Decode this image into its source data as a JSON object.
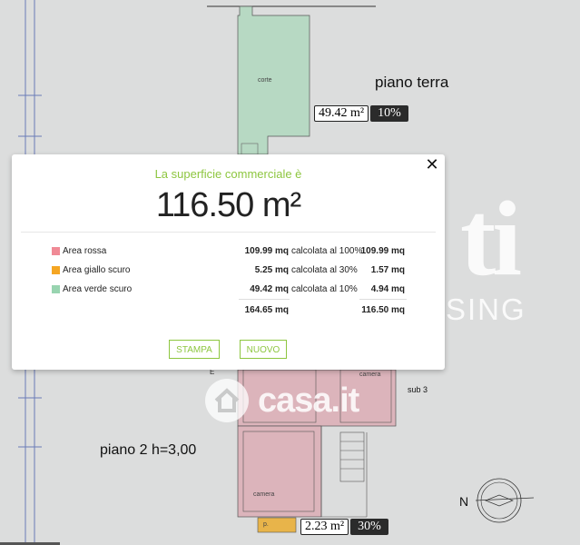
{
  "plan": {
    "piano_terra": "piano terra",
    "piano_2": "piano 2 h=3,00",
    "sub3": "sub 3",
    "north": "N",
    "rooms": {
      "corte": "corte",
      "camera": "camera",
      "e": "E",
      "p": "p."
    },
    "tags": [
      {
        "value": "49.42 m²",
        "pct": "10%"
      },
      {
        "value": "2.23 m²",
        "pct": "30%"
      }
    ],
    "watermark_ti": "ti",
    "watermark_sing": "SING",
    "logo_text": "casa.it",
    "colors": {
      "green_area": "#b7d9c3",
      "red_area": "#dcb4bb",
      "yellow_area": "#e8b44a"
    }
  },
  "modal": {
    "title": "La superficie commerciale è",
    "total": "116.50 m²",
    "rows": [
      {
        "name": "Area",
        "color_word": "rossa",
        "swatch": "#f08a96",
        "mq": "109.99 mq",
        "calc": "calcolata al 100%",
        "result": "109.99 mq"
      },
      {
        "name": "Area",
        "color_word": "giallo scuro",
        "swatch": "#f5a623",
        "mq": "5.25 mq",
        "calc": "calcolata al 30%",
        "result": "1.57 mq"
      },
      {
        "name": "Area",
        "color_word": "verde scuro",
        "swatch": "#98d4b0",
        "mq": "49.42 mq",
        "calc": "calcolata al 10%",
        "result": "4.94 mq"
      }
    ],
    "sum_mq": "164.65 mq",
    "sum_result": "116.50 mq",
    "buttons": {
      "print": "STAMPA",
      "new": "NUOVO"
    },
    "accent": "#8dc63f"
  }
}
